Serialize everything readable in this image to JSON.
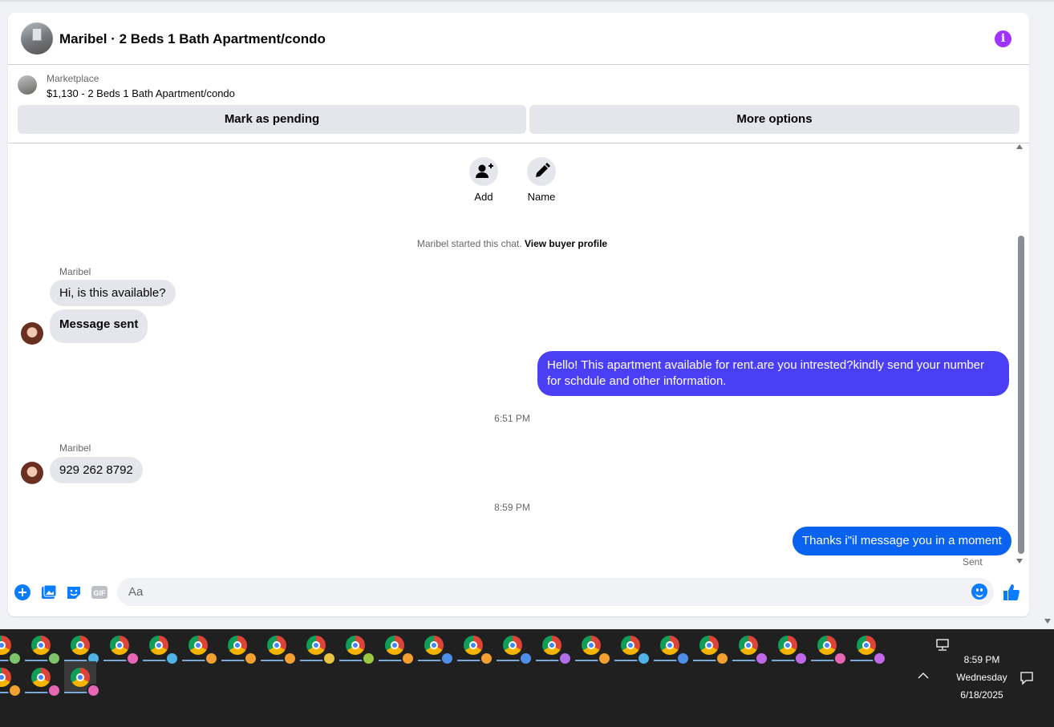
{
  "header": {
    "title": "Maribel · 2 Beds 1 Bath Apartment/condo",
    "info_icon": "info-icon"
  },
  "marketplace": {
    "label": "Marketplace",
    "listing": "$1,130 - 2 Beds 1 Bath Apartment/condo",
    "mark_pending": "Mark as pending",
    "more_options": "More options"
  },
  "actions": {
    "add": "Add",
    "name": "Name"
  },
  "chat": {
    "started_text": "Maribel started this chat.",
    "view_profile": "View buyer profile",
    "messages": [
      {
        "sender": "Maribel",
        "text": "Hi, is this available?"
      },
      {
        "text": "Message sent"
      },
      {
        "text": "Hello! This apartment available for rent.are you intrested?kindly send your number for schdule and other information."
      },
      {
        "time": "6:51 PM"
      },
      {
        "sender": "Maribel",
        "text": "929 262 8792"
      },
      {
        "time": "8:59 PM"
      },
      {
        "text": "Thanks i\"il message you in a moment"
      }
    ],
    "status": "Sent"
  },
  "composer": {
    "placeholder": "Aa"
  },
  "colors": {
    "accent": "#0a7cff",
    "outgoing_bubble": "#4b3ff5",
    "info": "#a033ff"
  },
  "taskbar": {
    "profile_colors_row1": [
      "#7ec46c",
      "#7ec46c",
      "#4fb3e8",
      "#e867b5",
      "#4fb3e8",
      "#f4a030",
      "#f4a030",
      "#f4a030",
      "#e8c440",
      "#9ac840",
      "#f4a030",
      "#4f8ee8",
      "#f4a030",
      "#4f8ee8",
      "#b06ee8",
      "#f4a030",
      "#4fb3e8",
      "#4f8ee8",
      "#f4a030",
      "#c069e8",
      "#c069e8",
      "#e867b5",
      "#c069e8"
    ],
    "profile_colors_row2": [
      "#f4a030",
      "#e867b5",
      "#e867b5"
    ],
    "time": "8:59 PM",
    "day": "Wednesday",
    "date": "6/18/2025"
  }
}
